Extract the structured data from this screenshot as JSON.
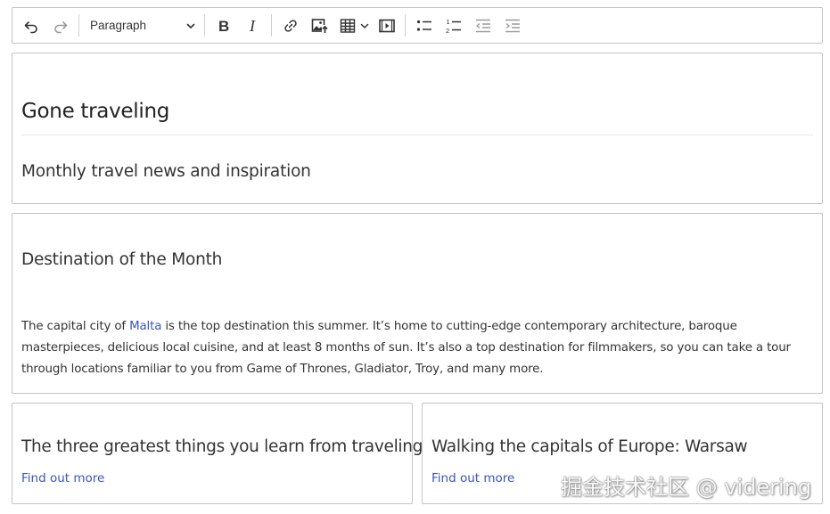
{
  "toolbar": {
    "undo": "undo-icon",
    "redo": "redo-icon",
    "heading_value": "Paragraph",
    "bold": "bold-icon",
    "italic": "italic-icon",
    "link": "link-icon",
    "image": "image-upload-icon",
    "table": "table-icon",
    "media": "media-embed-icon",
    "bulleted_list": "bulleted-list-icon",
    "numbered_list": "numbered-list-icon",
    "outdent": "outdent-icon",
    "indent": "indent-icon"
  },
  "header_block": {
    "title": "Gone traveling",
    "subtitle": "Monthly travel news and inspiration"
  },
  "destination_block": {
    "heading": "Destination of the Month",
    "para_before": "The capital city of ",
    "link_text": "Malta",
    "para_after": " is the top destination this summer. It’s home to cutting-edge contemporary architecture, baroque masterpieces, delicious local cuisine, and at least 8 months of sun. It’s also a top destination for filmmakers, so you can take a tour through locations familiar to you from Game of Thrones, Gladiator, Troy, and many more."
  },
  "cards": [
    {
      "title": "The three greatest things you learn from traveling",
      "link": "Find out more"
    },
    {
      "title": "Walking the capitals of Europe: Warsaw",
      "link": "Find out more"
    }
  ],
  "watermark": "掘金技术社区 @ videring",
  "colors": {
    "link": "#3a55c0",
    "border": "#c4c4c4",
    "text": "#333333"
  }
}
